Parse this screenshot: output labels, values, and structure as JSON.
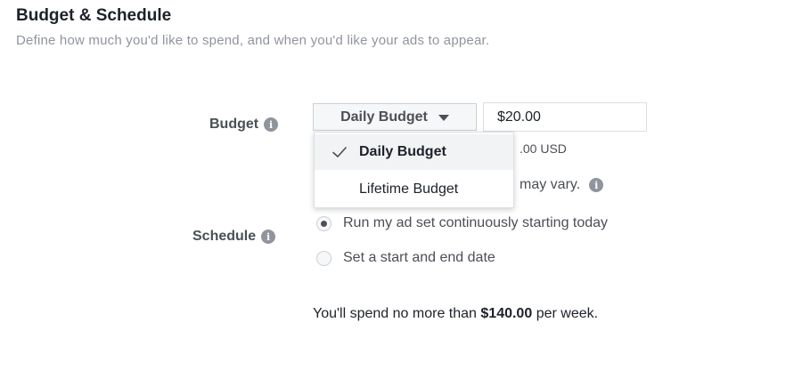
{
  "header": {
    "title": "Budget & Schedule",
    "subtitle": "Define how much you'd like to spend, and when you'd like your ads to appear."
  },
  "budget": {
    "label": "Budget",
    "info_glyph": "i",
    "select_value": "Daily Budget",
    "amount": "$20.00",
    "helper_usd": ".00 USD",
    "helper_vary": "may vary.",
    "dropdown": {
      "items": [
        {
          "label": "Daily Budget",
          "selected": true
        },
        {
          "label": "Lifetime Budget",
          "selected": false
        }
      ]
    }
  },
  "schedule": {
    "label": "Schedule",
    "info_glyph": "i",
    "options": [
      {
        "label": "Run my ad set continuously starting today",
        "checked": true
      },
      {
        "label": "Set a start and end date",
        "checked": false
      }
    ]
  },
  "spend_note": {
    "prefix": "You'll spend no more than",
    "amount": "$140.00",
    "suffix": "per week."
  },
  "colors": {
    "text_dark": "#1d2129",
    "text_muted": "#90949c",
    "label_gray": "#4b4f56",
    "border": "#ccd0d5",
    "menu_highlight": "#f2f3f5"
  }
}
